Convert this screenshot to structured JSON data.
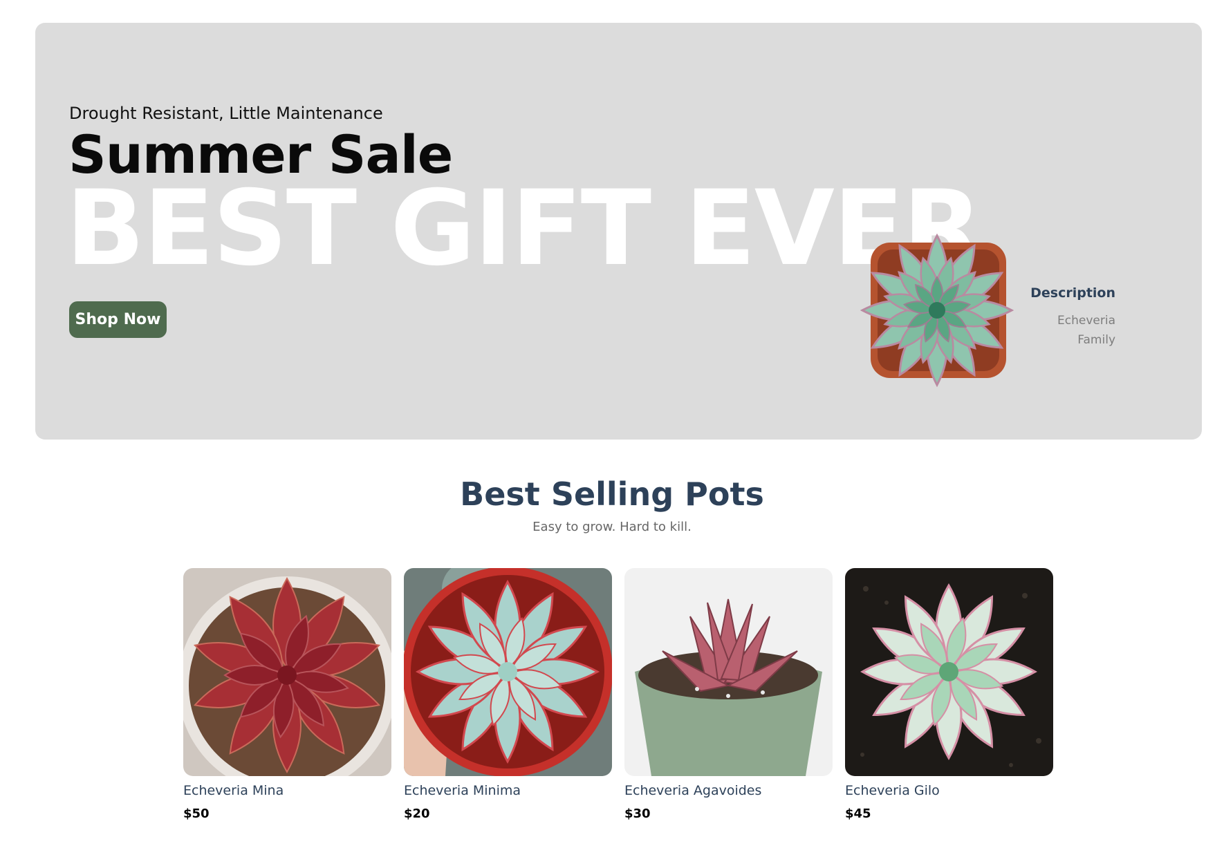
{
  "hero": {
    "eyebrow": "Drought Resistant, Little Maintenance",
    "headline": "Summer Sale",
    "bigword": "BEST GIFT EVER",
    "cta_label": "Shop Now",
    "description": {
      "title": "Description",
      "line1": "Echeveria",
      "line2": "Family"
    },
    "colors": {
      "background": "#dcdcdc",
      "cta": "#4f6b4e"
    }
  },
  "best_selling": {
    "title": "Best Selling Pots",
    "subtitle": "Easy to grow. Hard to kill.",
    "products": [
      {
        "name": "Echeveria Mina",
        "price": "$50",
        "theme": "red"
      },
      {
        "name": "Echeveria Minima",
        "price": "$20",
        "theme": "blue"
      },
      {
        "name": "Echeveria Agavoides",
        "price": "$30",
        "theme": "agavoides"
      },
      {
        "name": "Echeveria Gilo",
        "price": "$45",
        "theme": "mint"
      }
    ]
  }
}
